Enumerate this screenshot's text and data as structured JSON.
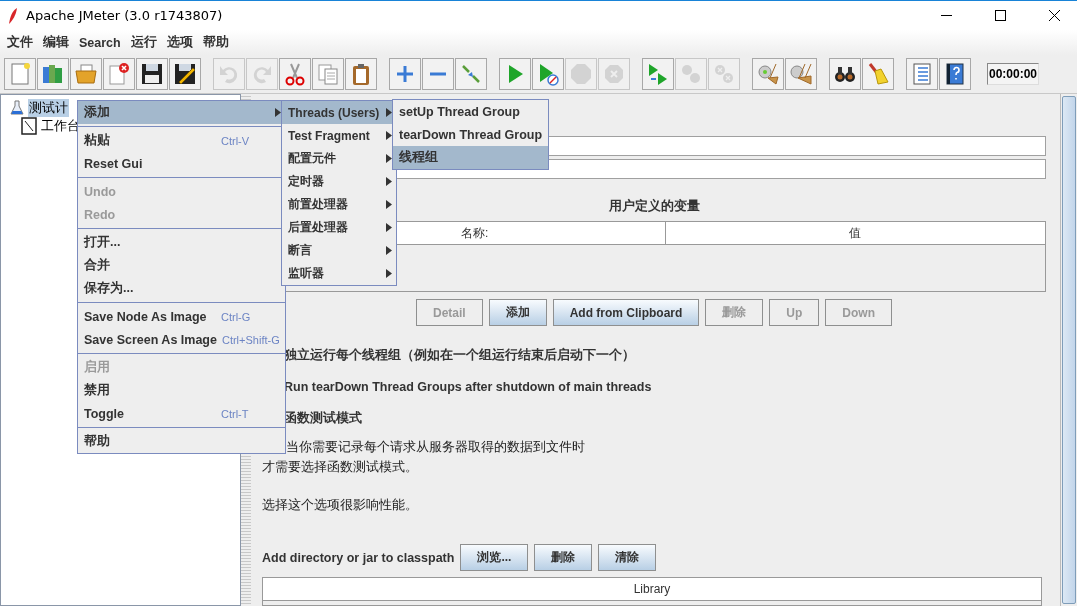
{
  "window": {
    "title": "Apache JMeter (3.0 r1743807)"
  },
  "menu_bar": [
    "文件",
    "编辑",
    "Search",
    "运行",
    "选项",
    "帮助"
  ],
  "toolbar": {
    "groups": [
      [
        {
          "kind": "new",
          "disabled": false
        },
        {
          "kind": "templates",
          "disabled": false
        },
        {
          "kind": "open",
          "disabled": false
        },
        {
          "kind": "close",
          "disabled": false
        },
        {
          "kind": "save",
          "disabled": false
        },
        {
          "kind": "save-as",
          "disabled": false
        }
      ],
      [
        {
          "kind": "undo",
          "disabled": true
        },
        {
          "kind": "redo",
          "disabled": true
        },
        {
          "kind": "cut",
          "disabled": false
        },
        {
          "kind": "copy",
          "disabled": false
        },
        {
          "kind": "paste",
          "disabled": false
        }
      ],
      [
        {
          "kind": "expand",
          "disabled": false
        },
        {
          "kind": "collapse",
          "disabled": false
        },
        {
          "kind": "toggle",
          "disabled": false
        }
      ],
      [
        {
          "kind": "start",
          "disabled": false
        },
        {
          "kind": "start-no-pause",
          "disabled": false
        },
        {
          "kind": "stop",
          "disabled": true
        },
        {
          "kind": "shutdown",
          "disabled": true
        }
      ],
      [
        {
          "kind": "remote-start",
          "disabled": false
        },
        {
          "kind": "remote-stop",
          "disabled": true
        },
        {
          "kind": "remote-shutdown",
          "disabled": true
        }
      ],
      [
        {
          "kind": "clear",
          "disabled": false
        },
        {
          "kind": "clear-all",
          "disabled": false
        }
      ],
      [
        {
          "kind": "search",
          "disabled": false
        },
        {
          "kind": "reset-search",
          "disabled": false
        }
      ],
      [
        {
          "kind": "function-helper",
          "disabled": false
        },
        {
          "kind": "help",
          "disabled": false
        }
      ]
    ],
    "timer": "00:00:00"
  },
  "tree": [
    {
      "label": "测试计",
      "kind": "test-plan",
      "selected": true
    },
    {
      "label": "工作台",
      "kind": "workbench",
      "selected": false
    }
  ],
  "panel": {
    "variables": {
      "title": "用户定义的变量",
      "columns": [
        "名称:",
        "值"
      ]
    },
    "buttons": [
      {
        "label": "Detail",
        "disabled": true
      },
      {
        "label": "添加",
        "disabled": false
      },
      {
        "label": "Add from Clipboard",
        "disabled": false
      },
      {
        "label": "删除",
        "disabled": true
      },
      {
        "label": "Up",
        "disabled": true
      },
      {
        "label": "Down",
        "disabled": true
      }
    ],
    "options": [
      "独立运行每个线程组（例如在一个组运行结束后启动下一个）",
      "Run tearDown Thread Groups after shutdown of main threads",
      "函数测试模式"
    ],
    "notes": [
      "当你需要记录每个请求从服务器取得的数据到文件时",
      "才需要选择函数测试模式。"
    ],
    "warning": "选择这个选项很影响性能。",
    "classpath": {
      "label": "Add directory or jar to classpath",
      "buttons": [
        "浏览...",
        "删除",
        "清除"
      ],
      "columns": [
        "Library"
      ]
    }
  },
  "context_menus": [
    {
      "items": [
        {
          "kind": "item",
          "label": "添加",
          "submenu": true,
          "selected": true,
          "disabled": false
        },
        {
          "kind": "separator"
        },
        {
          "kind": "item",
          "label": "粘贴",
          "shortcut": "Ctrl-V",
          "selected": false,
          "disabled": false
        },
        {
          "kind": "item",
          "label": "Reset Gui",
          "selected": false,
          "disabled": false
        },
        {
          "kind": "separator"
        },
        {
          "kind": "item",
          "label": "Undo",
          "selected": false,
          "disabled": true
        },
        {
          "kind": "item",
          "label": "Redo",
          "selected": false,
          "disabled": true
        },
        {
          "kind": "separator"
        },
        {
          "kind": "item",
          "label": "打开...",
          "selected": false,
          "disabled": false
        },
        {
          "kind": "item",
          "label": "合并",
          "selected": false,
          "disabled": false
        },
        {
          "kind": "item",
          "label": "保存为...",
          "selected": false,
          "disabled": false
        },
        {
          "kind": "separator"
        },
        {
          "kind": "item",
          "label": "Save Node As Image",
          "shortcut": "Ctrl-G",
          "selected": false,
          "disabled": false
        },
        {
          "kind": "item",
          "label": "Save Screen As Image",
          "shortcut": "Ctrl+Shift-G",
          "selected": false,
          "disabled": false
        },
        {
          "kind": "separator"
        },
        {
          "kind": "item",
          "label": "启用",
          "selected": false,
          "disabled": true
        },
        {
          "kind": "item",
          "label": "禁用",
          "selected": false,
          "disabled": false
        },
        {
          "kind": "item",
          "label": "Toggle",
          "shortcut": "Ctrl-T",
          "selected": false,
          "disabled": false
        },
        {
          "kind": "separator"
        },
        {
          "kind": "item",
          "label": "帮助",
          "selected": false,
          "disabled": false
        }
      ]
    },
    {
      "items": [
        {
          "kind": "item",
          "label": "Threads (Users)",
          "submenu": true,
          "selected": true,
          "disabled": false
        },
        {
          "kind": "item",
          "label": "Test Fragment",
          "submenu": true,
          "selected": false,
          "disabled": false
        },
        {
          "kind": "item",
          "label": "配置元件",
          "submenu": true,
          "selected": false,
          "disabled": false
        },
        {
          "kind": "item",
          "label": "定时器",
          "submenu": true,
          "selected": false,
          "disabled": false
        },
        {
          "kind": "item",
          "label": "前置处理器",
          "submenu": true,
          "selected": false,
          "disabled": false
        },
        {
          "kind": "item",
          "label": "后置处理器",
          "submenu": true,
          "selected": false,
          "disabled": false
        },
        {
          "kind": "item",
          "label": "断言",
          "submenu": true,
          "selected": false,
          "disabled": false
        },
        {
          "kind": "item",
          "label": "监听器",
          "submenu": true,
          "selected": false,
          "disabled": false
        }
      ]
    },
    {
      "items": [
        {
          "kind": "item",
          "label": "setUp Thread Group",
          "selected": false,
          "disabled": false
        },
        {
          "kind": "item",
          "label": "tearDown Thread Group",
          "selected": false,
          "disabled": false
        },
        {
          "kind": "item",
          "label": "线程组",
          "selected": true,
          "disabled": false
        }
      ]
    }
  ]
}
